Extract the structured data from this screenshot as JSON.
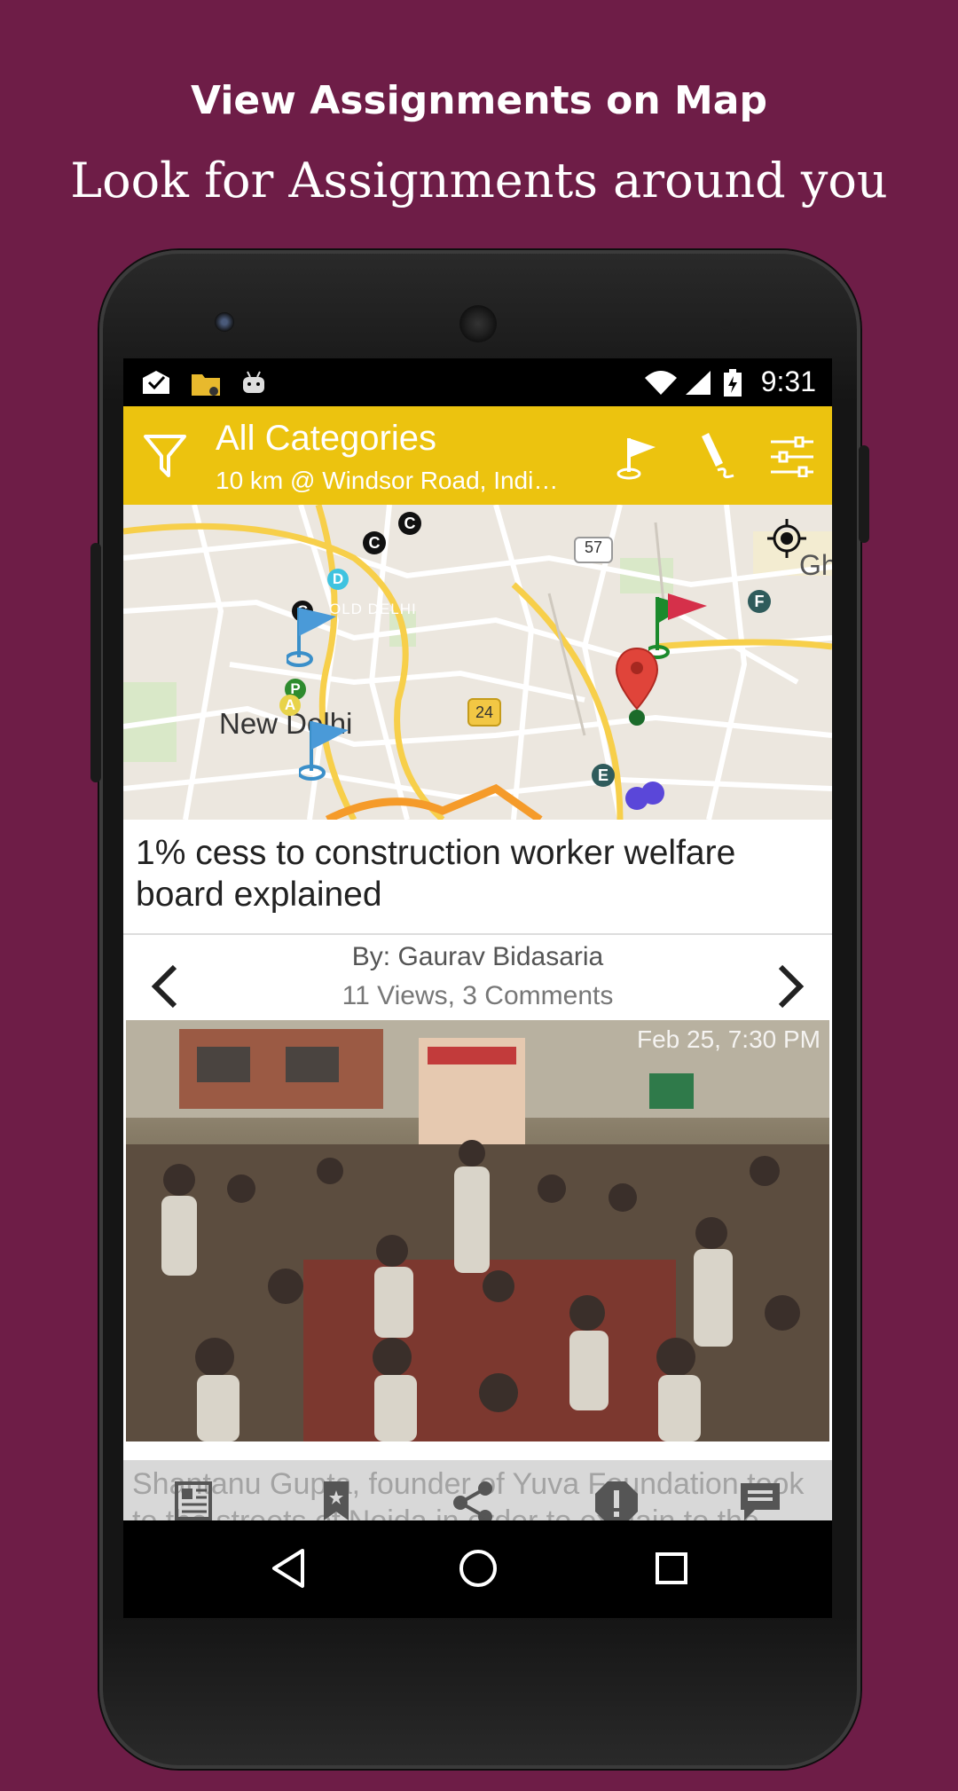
{
  "promo": {
    "title": "View Assignments on Map",
    "subtitle": "Look for Assignments around you"
  },
  "status_bar": {
    "time": "9:31",
    "icons": [
      "mail-check-icon",
      "folder-icon",
      "android-icon",
      "wifi-icon",
      "signal-icon",
      "battery-icon"
    ]
  },
  "app_bar": {
    "title": "All Categories",
    "subtitle": "10 km @ Windsor Road, Indi…",
    "icons": [
      "filter-icon",
      "flag-icon",
      "pen-icon",
      "settings-sliders-icon"
    ],
    "color": "#ecc30f"
  },
  "map": {
    "labels": {
      "city": "New Delhi",
      "old_delhi": "OLD DELHI",
      "highway_57": "57",
      "highway_24": "24",
      "edge": "Gh"
    },
    "markers": [
      "C",
      "C",
      "C",
      "D",
      "P",
      "A",
      "E",
      "F"
    ]
  },
  "article": {
    "headline": "1% cess to construction worker welfare board explained",
    "byline": "By: Gaurav Bidasaria",
    "stats": "11 Views, 3 Comments",
    "photo_date": "Feb 25, 7:30 PM",
    "snippet": "Shantanu Gupta, founder of Yuva Foundation took to the streets of Noida in order to explain to the"
  },
  "bottom_bar": {
    "icons": [
      "article-icon",
      "bookmark-icon",
      "share-icon",
      "report-icon",
      "comment-icon"
    ]
  },
  "nav_bar": {
    "icons": [
      "back-icon",
      "home-icon",
      "recents-icon"
    ]
  }
}
